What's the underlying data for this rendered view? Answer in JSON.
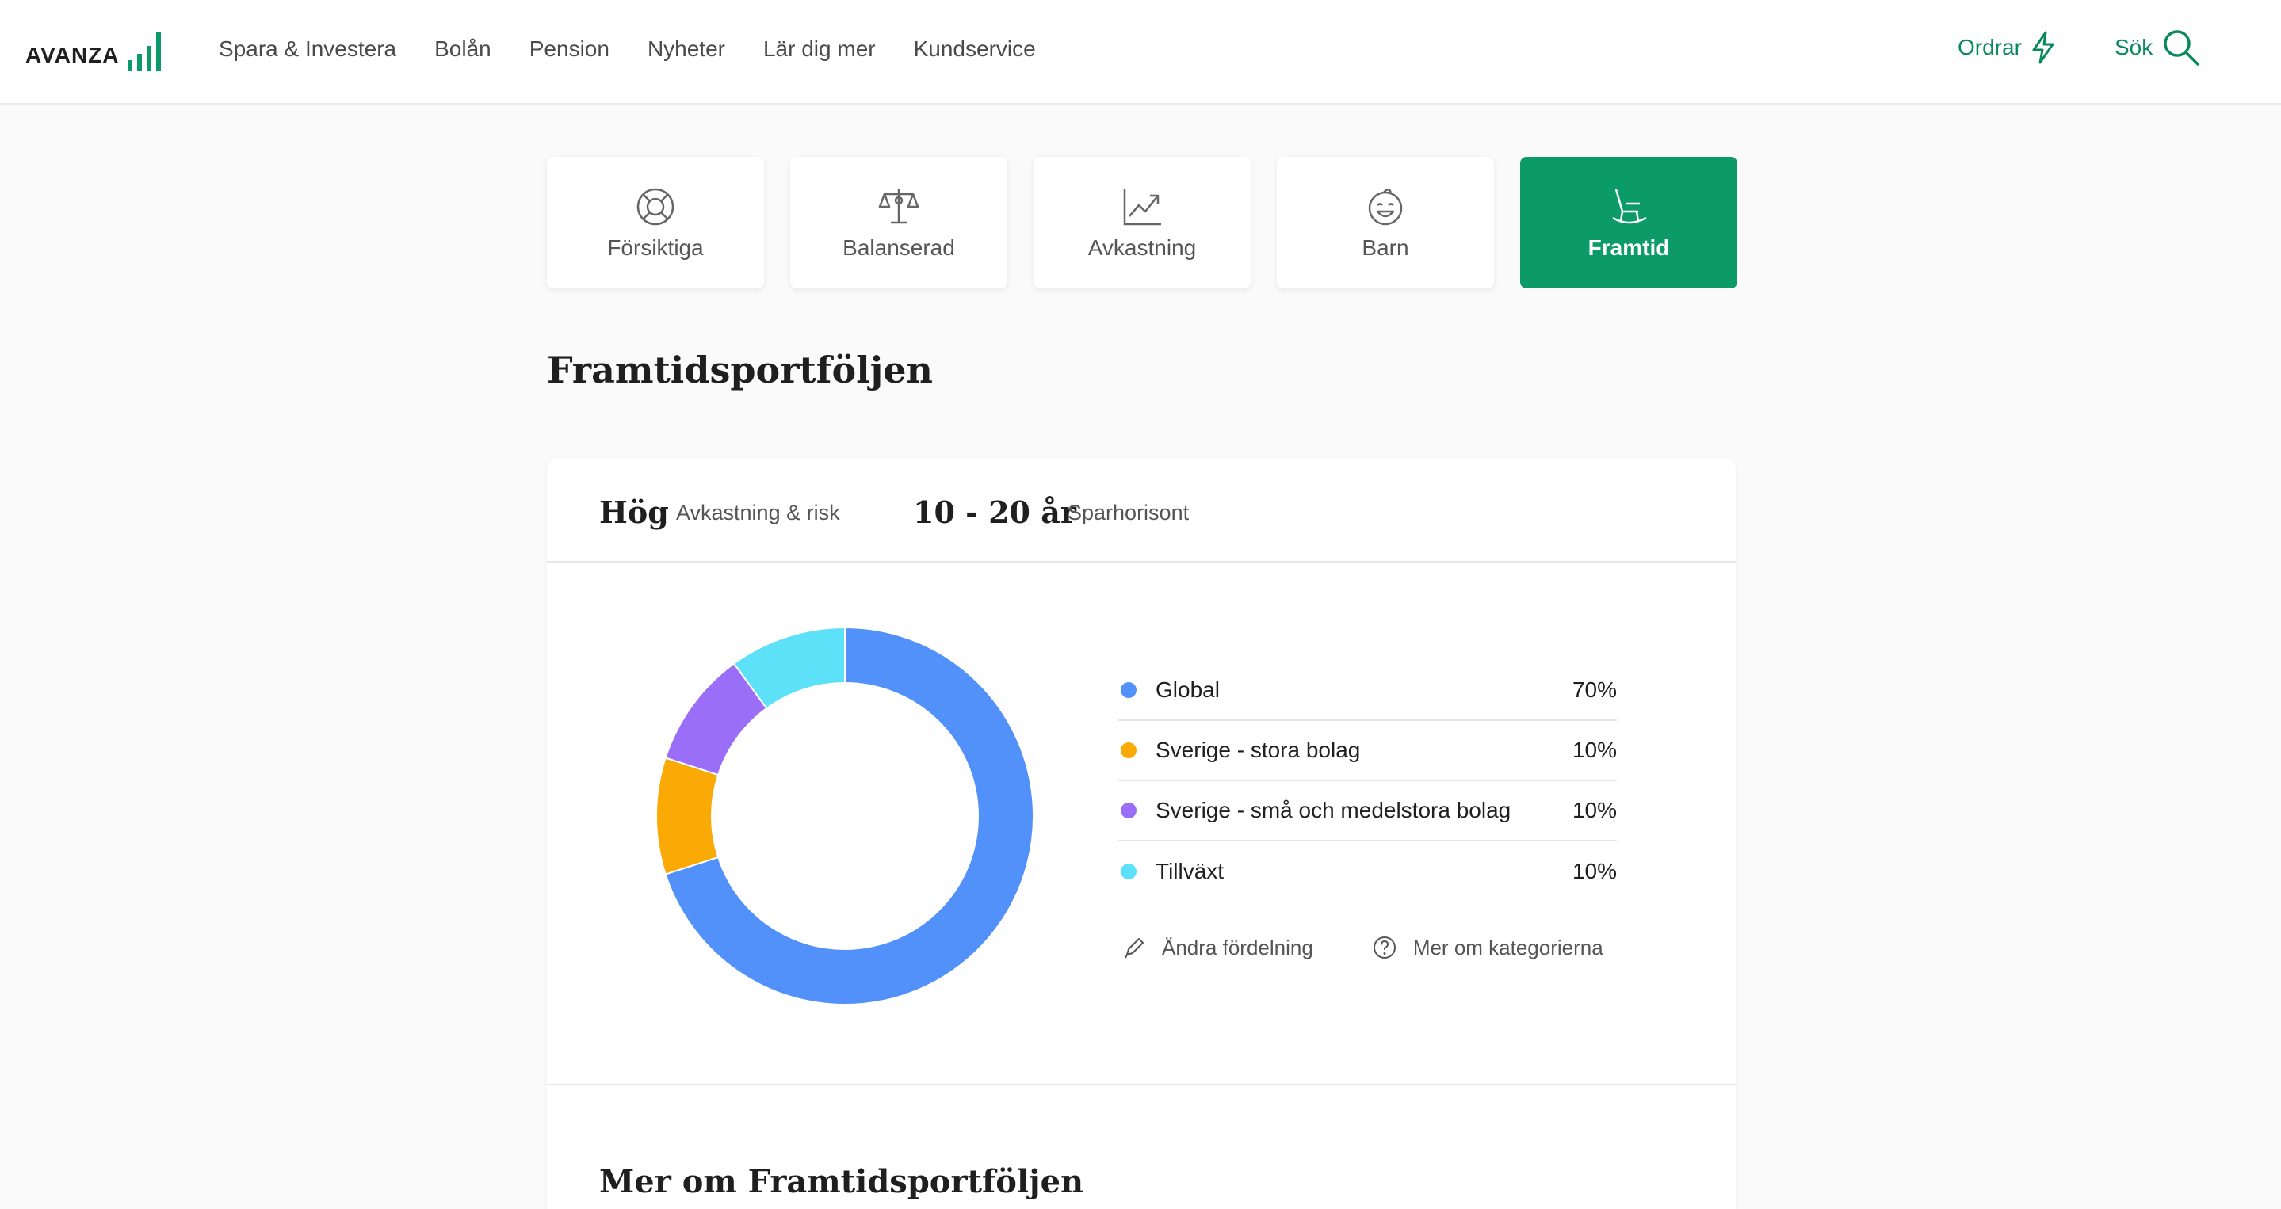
{
  "header": {
    "logo_text": "AVANZA",
    "nav": [
      "Spara & Investera",
      "Bolån",
      "Pension",
      "Nyheter",
      "Lär dig mer",
      "Kundservice"
    ],
    "orders_label": "Ordrar",
    "search_label": "Sök",
    "accent_color": "#0a8a5a"
  },
  "tabs": [
    {
      "label": "Försiktiga",
      "icon": "lifebuoy-icon",
      "active": false
    },
    {
      "label": "Balanserad",
      "icon": "scale-icon",
      "active": false
    },
    {
      "label": "Avkastning",
      "icon": "chart-up-icon",
      "active": false
    },
    {
      "label": "Barn",
      "icon": "baby-icon",
      "active": false
    },
    {
      "label": "Framtid",
      "icon": "rocking-chair-icon",
      "active": true
    }
  ],
  "page_title": "Framtidsportföljen",
  "card": {
    "risk_value": "Hög",
    "risk_label": "Avkastning & risk",
    "horizon_value": "10 - 20 år",
    "horizon_label": "Sparhorisont",
    "actions": {
      "edit_label": "Ändra fördelning",
      "info_label": "Mer om kategorierna"
    },
    "more_title": "Mer om Framtidsportföljen"
  },
  "chart_data": {
    "type": "pie",
    "categories": [
      "Global",
      "Sverige - stora bolag",
      "Sverige - små och medelstora bolag",
      "Tillväxt"
    ],
    "values": [
      70,
      10,
      10,
      10
    ],
    "labels": [
      "70%",
      "10%",
      "10%",
      "10%"
    ],
    "colors": [
      "#5291f9",
      "#fbaa05",
      "#9a6ef6",
      "#5ce1f8"
    ],
    "legend_position": "right"
  }
}
